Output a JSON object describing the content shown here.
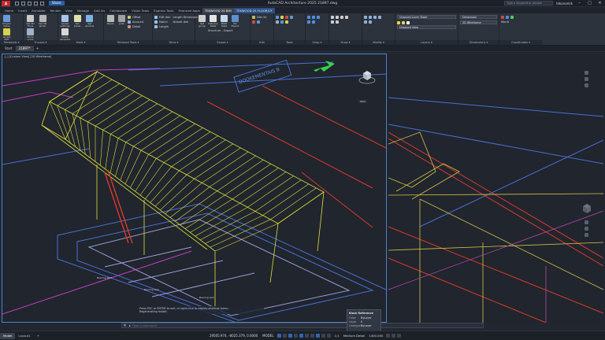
{
  "titlebar": {
    "logo": "A CAD",
    "share": "Share",
    "title": "AutoCAD Architecture 2025   21897.dwg",
    "search_placeholder": "Type a keyword or phrase",
    "user": "tekonomik",
    "minimize": "–",
    "maximize": "□",
    "close": "✕"
  },
  "tabs": [
    "Home",
    "Insert",
    "Annotate",
    "Render",
    "View",
    "Manage",
    "Add-ins",
    "Collaborate",
    "Vision Tools",
    "Express Tools",
    "Featured Apps",
    "TEKWOOD 25 BIM",
    "TEKWOOD 25 FLOOR/CF"
  ],
  "active_tab": "TEKWOOD 25 BIM",
  "ribbon": {
    "panels": [
      {
        "title": "Tekwoods ▾",
        "buttons": [
          "Project Setup",
          "Global Edit"
        ]
      },
      {
        "title": "Trusses ▾",
        "buttons": [
          "Set 3D Truss",
          "Set 3D girder",
          "Show cross plate"
        ]
      },
      {
        "title": "Walls ▾",
        "buttons": [
          "Global settings",
          "Set panel",
          "Set window",
          "Quick generate"
        ]
      },
      {
        "title": "Tekwood Tools ▾",
        "buttons": [
          "Beam",
          "Joist"
        ],
        "rows": [
          "Offset",
          "Account",
          "Detail"
        ]
      },
      {
        "title": "Dims ▾",
        "rows": [
          "Edit dim",
          "Match",
          "Length",
          "Length Dimension",
          "Istheet dim"
        ]
      },
      {
        "title": "Export ▾",
        "buttons": [
          "Set group",
          "Delivery table",
          "BOM table",
          "IFC Export"
        ],
        "rows": [
          "Structure - Export"
        ]
      },
      {
        "title": "Edit",
        "rows": [
          "Dits 50"
        ]
      },
      {
        "title": "Tools",
        "rows": []
      },
      {
        "title": "Snap ▾",
        "rows": []
      },
      {
        "title": "Draw ▾",
        "rows": []
      },
      {
        "title": "Modify ▾",
        "rows": []
      },
      {
        "title": "Layers ▾",
        "dropdowns": [
          "Unsaved Layer State",
          "Unsaved View"
        ]
      },
      {
        "title": "Dimensions ▾",
        "rows": [
          "Dimension",
          "ISO-25"
        ]
      },
      {
        "title": "Coordinates ▾",
        "rows": [
          "World"
        ]
      }
    ],
    "layer_dropdown": "Unsaved Layer State",
    "view_dropdown": "Unsaved View",
    "dim_dropdown": "Dimension",
    "visual_style": "2D Wireframe"
  },
  "file_tabs": [
    "Start",
    "21897*"
  ],
  "active_file_tab": "21897*",
  "viewport_left": {
    "label": "[–] [Custom View] [2D Wireframe]",
    "wcs": "WCS"
  },
  "command": {
    "history_1": "Press ESC or ENTER to exit, or right-click to display shortcut menu.",
    "history_2": "Regenerating model.",
    "placeholder": "Type a command",
    "close": "✕"
  },
  "tooltip": {
    "title": "Block Reference",
    "rows": [
      {
        "key": "Color",
        "value": "ByLayer"
      },
      {
        "key": "Layer",
        "value": "0"
      },
      {
        "key": "Linetype",
        "value": "ByLayer"
      }
    ]
  },
  "status": {
    "layout_tabs": [
      "Model",
      "Layout1",
      "+"
    ],
    "active_layout": "Model",
    "coords": "29565.974, -8025.379, 0.0000",
    "model": "MODEL",
    "detail": "Medium Detail",
    "scale": "1:1",
    "elevation": "1400.000"
  },
  "colors": {
    "accent": "#2e67b1",
    "viewport_border": "#4c86c9",
    "truss_yellow": "#e0e13b",
    "red_member": "#d93a2b",
    "blue_line": "#4a6fd1",
    "magenta": "#c23fb8",
    "green_arrow": "#3ad04a"
  }
}
